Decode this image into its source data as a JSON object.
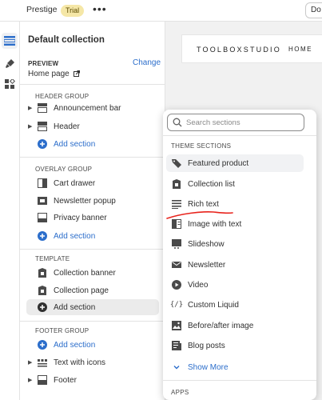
{
  "topbar": {
    "theme_name": "Prestige",
    "trial_badge": "Trial",
    "more_label": "•••",
    "right_button": "Do"
  },
  "sidebar": {
    "title": "Default collection",
    "preview_label": "PREVIEW",
    "change_label": "Change",
    "page_label": "Home page",
    "header_group": {
      "label": "HEADER GROUP",
      "items": [
        "Announcement bar",
        "Header"
      ],
      "add_label": "Add section"
    },
    "overlay_group": {
      "label": "OVERLAY GROUP",
      "items": [
        "Cart drawer",
        "Newsletter popup",
        "Privacy banner"
      ],
      "add_label": "Add section"
    },
    "template_group": {
      "label": "TEMPLATE",
      "items": [
        "Collection banner",
        "Collection page"
      ],
      "add_label": "Add section"
    },
    "footer_group": {
      "label": "FOOTER GROUP",
      "add_label": "Add section",
      "items": [
        "Text with icons",
        "Footer"
      ]
    }
  },
  "store_preview": {
    "brand": "TOOLBOXSTUDIO",
    "nav_item": "HOME"
  },
  "section_picker": {
    "search_placeholder": "Search sections",
    "theme_sections_label": "THEME SECTIONS",
    "items": [
      {
        "label": "Featured product",
        "icon": "tag-icon"
      },
      {
        "label": "Collection list",
        "icon": "collection-icon"
      },
      {
        "label": "Rich text",
        "icon": "text-lines-icon"
      },
      {
        "label": "Image with text",
        "icon": "image-text-icon"
      },
      {
        "label": "Slideshow",
        "icon": "slideshow-icon"
      },
      {
        "label": "Newsletter",
        "icon": "envelope-icon"
      },
      {
        "label": "Video",
        "icon": "play-icon"
      },
      {
        "label": "Custom Liquid",
        "icon": "code-icon"
      },
      {
        "label": "Before/after image",
        "icon": "image-icon"
      },
      {
        "label": "Blog posts",
        "icon": "blog-icon"
      }
    ],
    "show_more_label": "Show More",
    "apps_label": "APPS"
  },
  "colors": {
    "link_blue": "#2c6ecb",
    "trial_badge_bg": "#f5e7a7",
    "annotation_red": "#e8231c"
  }
}
